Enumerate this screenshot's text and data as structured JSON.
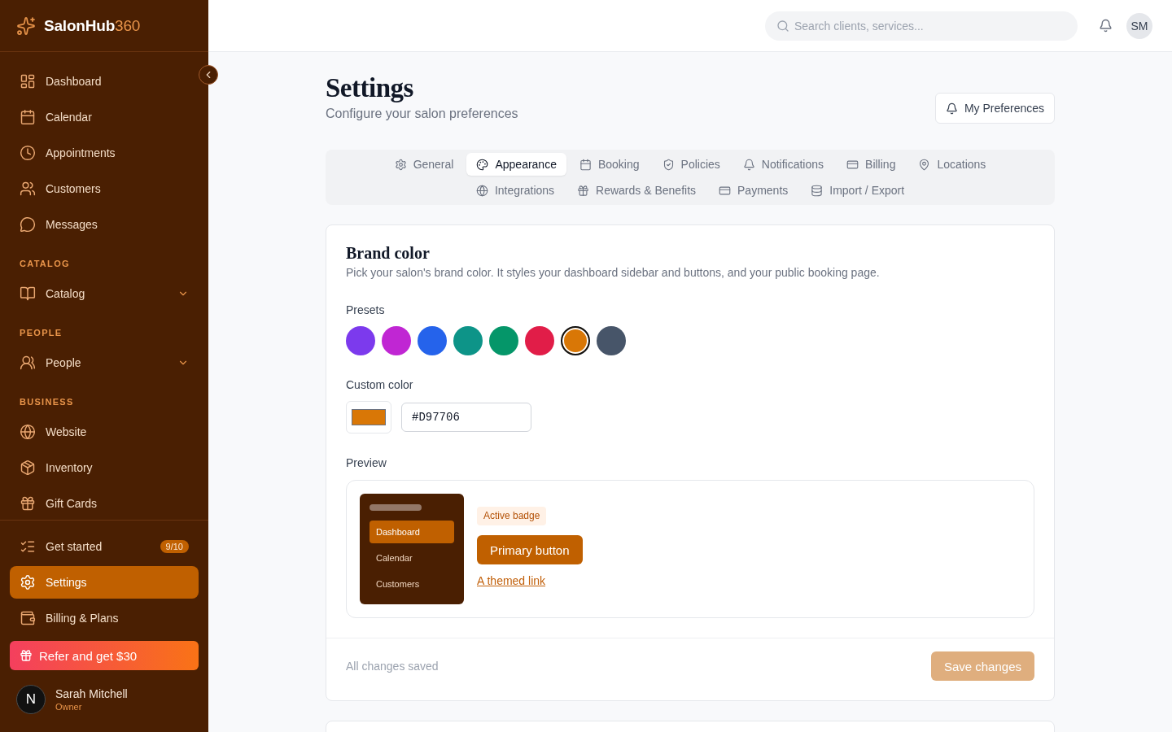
{
  "sidebar": {
    "brand": {
      "name": "SalonHub",
      "suffix": "360"
    },
    "main_nav": [
      {
        "label": "Dashboard",
        "selected": false
      },
      {
        "label": "Calendar",
        "selected": false
      },
      {
        "label": "Appointments",
        "selected": false
      },
      {
        "label": "Customers",
        "selected": false
      },
      {
        "label": "Messages",
        "selected": false
      }
    ],
    "sections": [
      {
        "heading": "CATALOG",
        "items": [
          {
            "label": "Catalog",
            "selected": false,
            "expanded": false
          }
        ]
      },
      {
        "heading": "PEOPLE",
        "items": [
          {
            "label": "People",
            "selected": false,
            "expanded": false
          }
        ]
      },
      {
        "heading": "BUSINESS",
        "items": [
          {
            "label": "Website",
            "selected": false
          },
          {
            "label": "Inventory",
            "selected": false
          },
          {
            "label": "Gift Cards",
            "selected": false
          }
        ]
      }
    ],
    "footer_nav": [
      {
        "label": "Get started",
        "selected": false,
        "badge": "9/10"
      },
      {
        "label": "Settings",
        "selected": true
      },
      {
        "label": "Billing & Plans",
        "selected": false
      }
    ],
    "referral_button": "Refer and get $30",
    "user": {
      "avatar": "N",
      "name": "Sarah Mitchell",
      "role": "Owner"
    }
  },
  "header": {
    "search": {
      "placeholder": "Search clients, services..."
    },
    "avatar": "SM"
  },
  "page": {
    "title": "Settings",
    "subtitle": "Configure your salon preferences",
    "preferences_button": "My Preferences"
  },
  "tabs": [
    {
      "label": "General",
      "selected": false
    },
    {
      "label": "Appearance",
      "selected": true
    },
    {
      "label": "Booking",
      "selected": false
    },
    {
      "label": "Policies",
      "selected": false
    },
    {
      "label": "Notifications",
      "selected": false
    },
    {
      "label": "Billing",
      "selected": false
    },
    {
      "label": "Locations",
      "selected": false
    },
    {
      "label": "Integrations",
      "selected": false
    },
    {
      "label": "Rewards & Benefits",
      "selected": false
    },
    {
      "label": "Payments",
      "selected": false
    },
    {
      "label": "Import / Export",
      "selected": false
    }
  ],
  "brand_color": {
    "title": "Brand color",
    "description": "Pick your salon's brand color. It styles your dashboard sidebar and buttons, and your public booking page.",
    "presets_label": "Presets",
    "presets": [
      {
        "color": "#7c3aed",
        "selected": false
      },
      {
        "color": "#c026d3",
        "selected": false
      },
      {
        "color": "#2563eb",
        "selected": false
      },
      {
        "color": "#0d9488",
        "selected": false
      },
      {
        "color": "#059669",
        "selected": false
      },
      {
        "color": "#e11d48",
        "selected": false
      },
      {
        "color": "#d97706",
        "selected": true
      },
      {
        "color": "#475569",
        "selected": false
      }
    ],
    "custom_label": "Custom color",
    "custom_value": "#D97706",
    "preview_label": "Preview",
    "preview": {
      "sidebar_items": [
        {
          "label": "Dashboard",
          "selected": true
        },
        {
          "label": "Calendar",
          "selected": false
        },
        {
          "label": "Customers",
          "selected": false
        }
      ],
      "badge": "Active badge",
      "button": "Primary button",
      "link": "A themed link"
    },
    "status": "All changes saved",
    "save_button": {
      "label": "Save changes",
      "disabled": true
    }
  }
}
